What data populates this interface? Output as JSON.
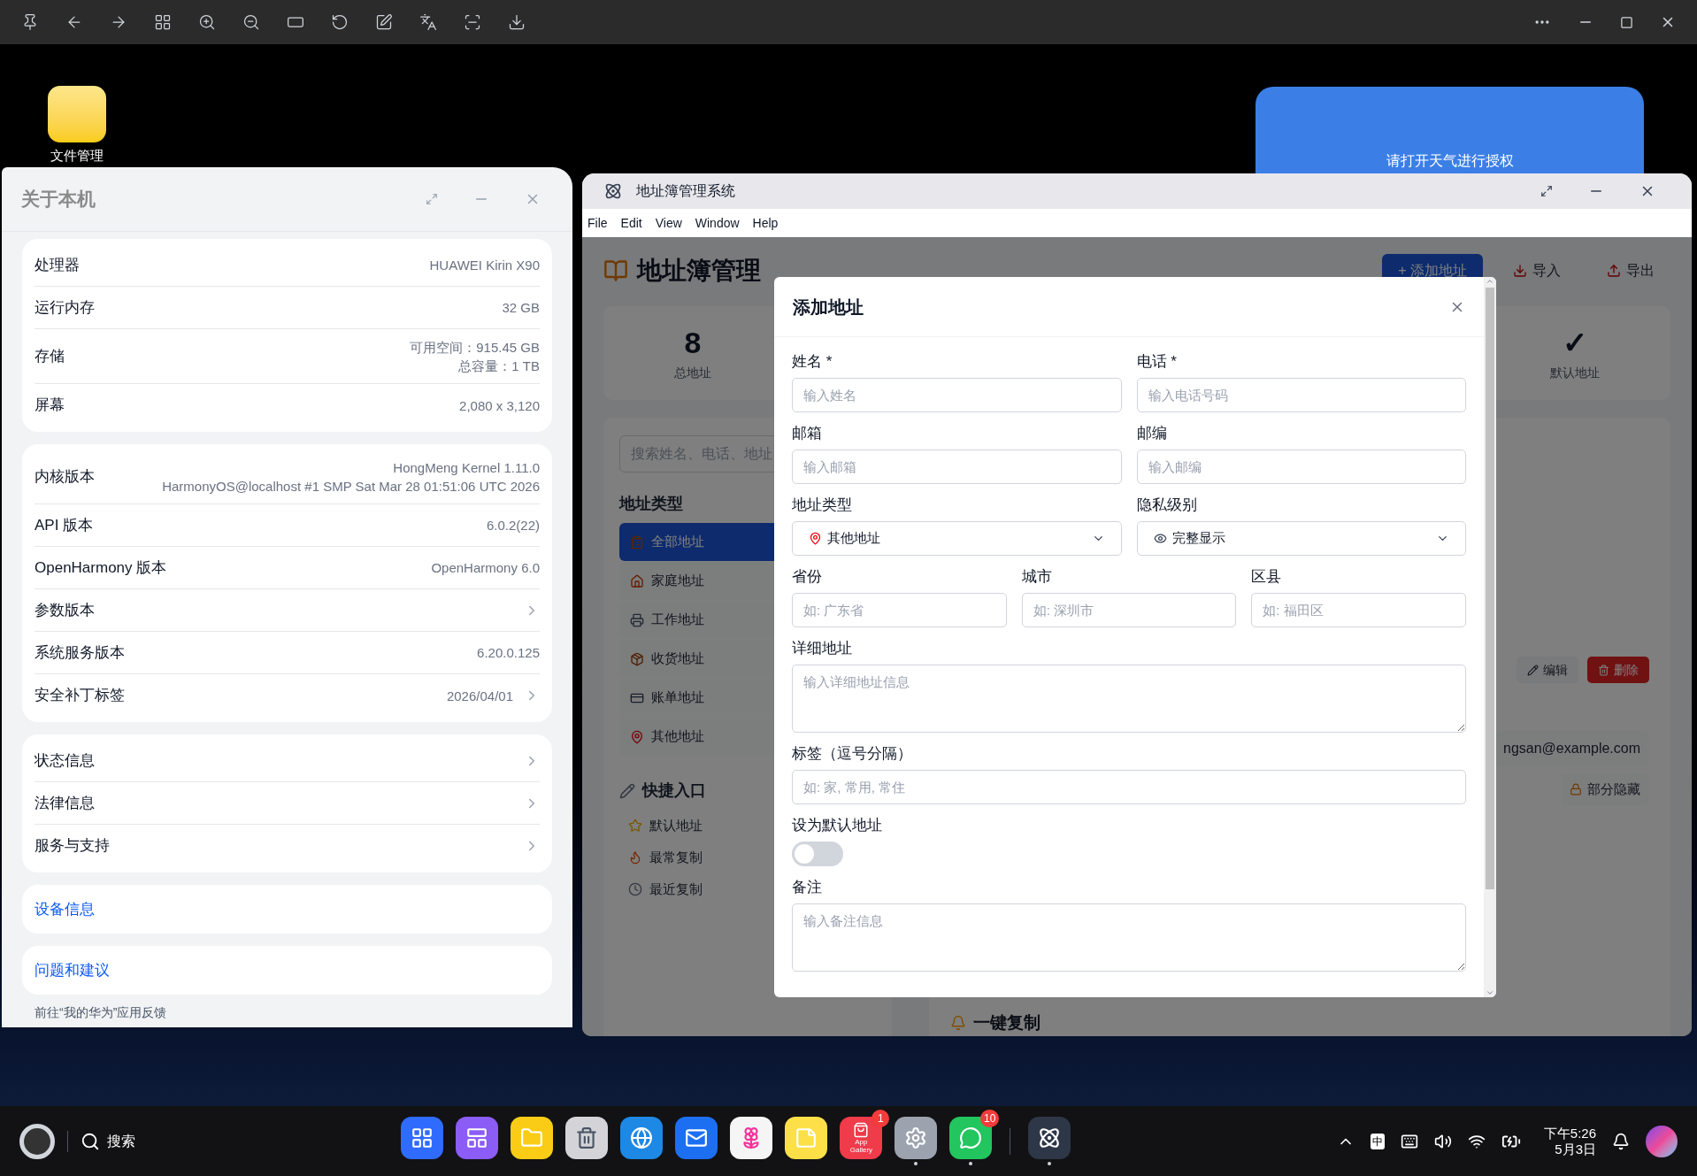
{
  "desktop_icons": [
    {
      "label": "文件管理"
    }
  ],
  "weather_widget": {
    "text": "请打开天气进行授权"
  },
  "about_window": {
    "title": "关于本机",
    "groups": [
      [
        {
          "label": "处理器",
          "values": [
            "HUAWEI Kirin X90"
          ],
          "kind": "info"
        },
        {
          "label": "运行内存",
          "values": [
            "32 GB"
          ],
          "kind": "info"
        },
        {
          "label": "存储",
          "values": [
            "可用空间：915.45 GB",
            "总容量：1 TB"
          ],
          "kind": "info"
        },
        {
          "label": "屏幕",
          "values": [
            "2,080 x 3,120"
          ],
          "kind": "info"
        }
      ],
      [
        {
          "label": "内核版本",
          "values": [
            "HongMeng Kernel 1.11.0",
            "HarmonyOS@localhost #1 SMP Sat Mar 28 01:51:06 UTC 2026"
          ],
          "kind": "info"
        },
        {
          "label": "API 版本",
          "values": [
            "6.0.2(22)"
          ],
          "kind": "info"
        },
        {
          "label": "OpenHarmony 版本",
          "values": [
            "OpenHarmony 6.0"
          ],
          "kind": "info"
        },
        {
          "label": "参数版本",
          "kind": "nav"
        },
        {
          "label": "系统服务版本",
          "values": [
            "6.20.0.125"
          ],
          "kind": "info"
        },
        {
          "label": "安全补丁标签",
          "values": [
            "2026/04/01"
          ],
          "kind": "nav"
        }
      ],
      [
        {
          "label": "状态信息",
          "kind": "nav"
        },
        {
          "label": "法律信息",
          "kind": "nav"
        },
        {
          "label": "服务与支持",
          "kind": "nav"
        }
      ]
    ],
    "links": [
      "设备信息",
      "问题和建议"
    ],
    "footer": "前往“我的华为”应用反馈"
  },
  "app_window": {
    "title": "地址簿管理系统",
    "menu": [
      "File",
      "Edit",
      "View",
      "Window",
      "Help"
    ],
    "header": {
      "title": "地址簿管理",
      "buttons": [
        {
          "label": "+ 添加地址",
          "kind": "primary"
        },
        {
          "label": "导入",
          "kind": "import"
        },
        {
          "label": "导出",
          "kind": "export"
        }
      ]
    },
    "stats": [
      {
        "value": "8",
        "label": "总地址"
      },
      {
        "value": "✓",
        "label": "默认地址"
      }
    ],
    "search": {
      "placeholder": "搜索姓名、电话、地址"
    },
    "sidebar": {
      "types_title": "地址类型",
      "types": [
        {
          "label": "全部地址",
          "selected": true
        },
        {
          "label": "家庭地址",
          "selected": false
        },
        {
          "label": "工作地址",
          "selected": false
        },
        {
          "label": "收货地址",
          "selected": false
        },
        {
          "label": "账单地址",
          "selected": false
        },
        {
          "label": "其他地址",
          "selected": false
        }
      ],
      "shortcuts_title": "快捷入口",
      "shortcuts": [
        {
          "label": "默认地址"
        },
        {
          "label": "最常复制"
        },
        {
          "label": "最近复制"
        }
      ]
    },
    "content": {
      "actions": [
        {
          "label": "编辑",
          "kind": "edit"
        },
        {
          "label": "删除",
          "kind": "delete"
        }
      ],
      "email": "ngsan@example.com",
      "privacy": "部分隐藏",
      "section_title": "一键复制"
    }
  },
  "dialog": {
    "title": "添加地址",
    "rows": [
      [
        {
          "label": "姓名 *",
          "kind": "input",
          "placeholder": "输入姓名"
        },
        {
          "label": "电话 *",
          "kind": "input",
          "placeholder": "输入电话号码"
        }
      ],
      [
        {
          "label": "邮箱",
          "kind": "input",
          "placeholder": "输入邮箱"
        },
        {
          "label": "邮编",
          "kind": "input",
          "placeholder": "输入邮编"
        }
      ],
      [
        {
          "label": "地址类型",
          "kind": "select",
          "value": "其他地址"
        },
        {
          "label": "隐私级别",
          "kind": "select",
          "value": "完整显示"
        }
      ],
      [
        {
          "label": "省份",
          "kind": "input",
          "placeholder": "如: 广东省"
        },
        {
          "label": "城市",
          "kind": "input",
          "placeholder": "如: 深圳市"
        },
        {
          "label": "区县",
          "kind": "input",
          "placeholder": "如: 福田区"
        }
      ],
      [
        {
          "label": "详细地址",
          "kind": "textarea",
          "placeholder": "输入详细地址信息"
        }
      ],
      [
        {
          "label": "标签（逗号分隔）",
          "kind": "input",
          "placeholder": "如: 家, 常用, 常住"
        }
      ],
      [
        {
          "label": "设为默认地址",
          "kind": "toggle",
          "on": false
        }
      ],
      [
        {
          "label": "备注",
          "kind": "textarea",
          "placeholder": "输入备注信息"
        }
      ]
    ]
  },
  "taskbar": {
    "search_label": "搜索",
    "apps": [
      {
        "kind": "grid",
        "running": false
      },
      {
        "kind": "windows",
        "running": false
      },
      {
        "kind": "folder",
        "running": false
      },
      {
        "kind": "trash",
        "running": false
      },
      {
        "kind": "browser",
        "running": false
      },
      {
        "kind": "mail",
        "running": false
      },
      {
        "kind": "photos",
        "running": false
      },
      {
        "kind": "notes",
        "running": false
      },
      {
        "kind": "gallery",
        "label": "App Gallery",
        "badge": "1",
        "running": false
      },
      {
        "kind": "settings",
        "running": true
      },
      {
        "kind": "chat",
        "badge": "10",
        "running": true
      },
      {
        "kind": "atom",
        "running": true
      }
    ],
    "ime": "中",
    "time": "下午5:26",
    "date": "5月3日"
  }
}
